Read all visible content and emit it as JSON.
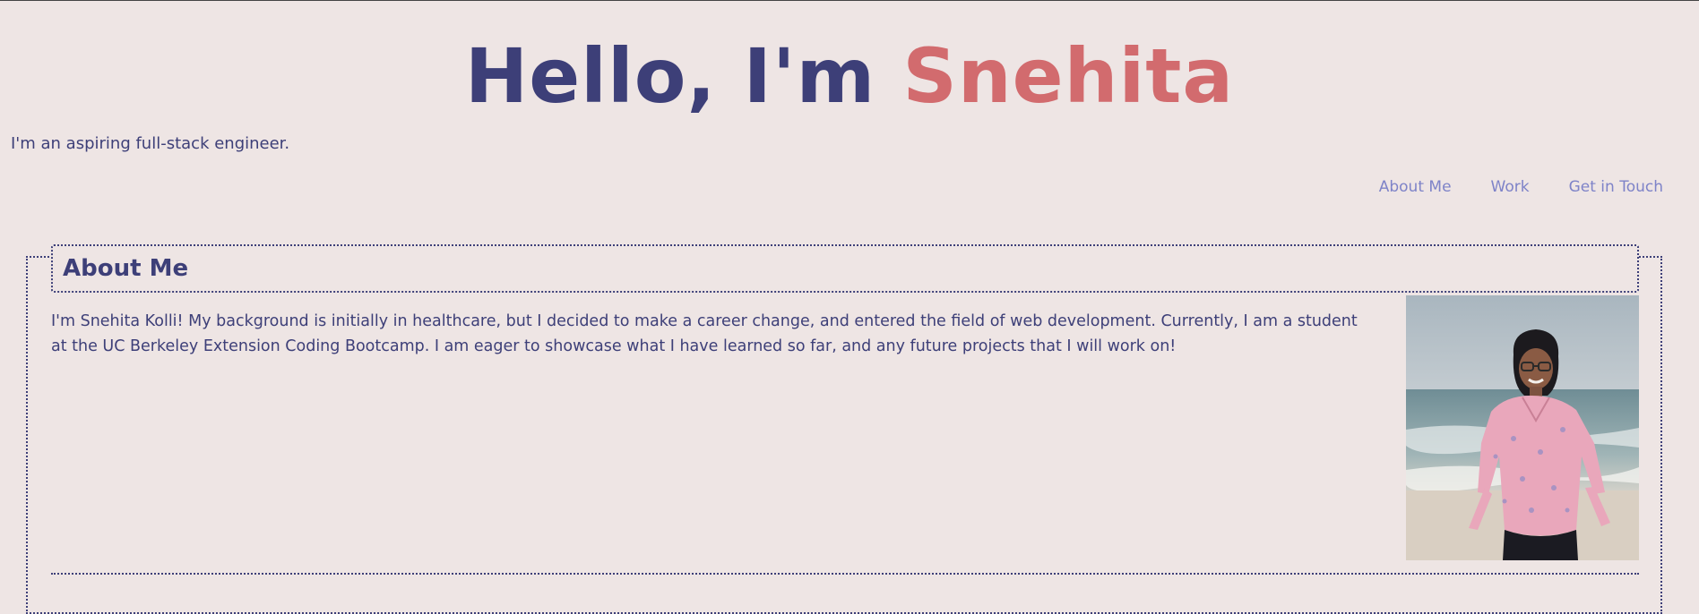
{
  "header": {
    "title_part1": "Hello, I'm ",
    "title_part2": "Snehita",
    "tagline": "I'm an aspiring full-stack engineer."
  },
  "nav": {
    "items": [
      {
        "label": "About Me"
      },
      {
        "label": "Work"
      },
      {
        "label": "Get in Touch"
      }
    ]
  },
  "about": {
    "heading": "About Me",
    "body": "I'm Snehita Kolli! My background is initially in healthcare, but I decided to make a career change, and entered the field of web development. Currently, I am a student at the UC Berkeley Extension Coding Bootcamp. I am eager to showcase what I have learned so far, and any future projects that I will work on!"
  },
  "colors": {
    "background": "#eee5e4",
    "primary": "#3d3f78",
    "accent": "#d26b6e",
    "nav_link": "#7e83c8"
  }
}
